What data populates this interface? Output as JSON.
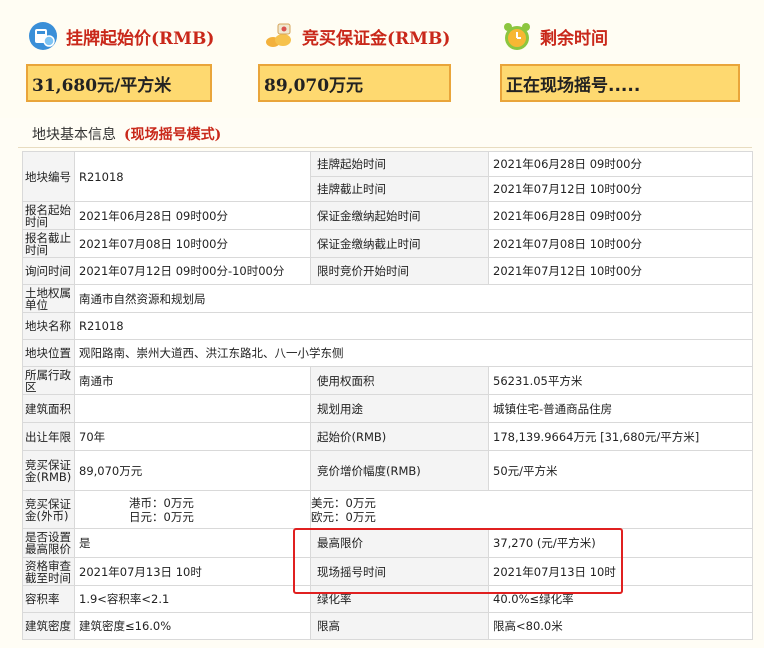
{
  "header": {
    "start_price": {
      "title": "挂牌起始价(RMB)",
      "value": "31,680元/平方米",
      "icon": "calculator-icon"
    },
    "deposit": {
      "title": "竞买保证金(RMB)",
      "value": "89,070万元",
      "icon": "coins-icon"
    },
    "remaining": {
      "title": "剩余时间",
      "value": "正在现场摇号.....",
      "icon": "alarm-clock-icon"
    }
  },
  "section": {
    "title": "地块基本信息",
    "mode": "(现场摇号模式)"
  },
  "rows": {
    "parcel_no_label": "地块编号",
    "parcel_no": "R21018",
    "list_start_label": "挂牌起始时间",
    "list_start": "2021年06月28日 09时00分",
    "list_end_label": "挂牌截止时间",
    "list_end": "2021年07月12日 10时00分",
    "reg_start_label": "报名起始时间",
    "reg_start": "2021年06月28日 09时00分",
    "dep_start_label": "保证金缴纳起始时间",
    "dep_start": "2021年06月28日 09时00分",
    "reg_end_label": "报名截止时间",
    "reg_end": "2021年07月08日 10时00分",
    "dep_end_label": "保证金缴纳截止时间",
    "dep_end": "2021年07月08日 10时00分",
    "inquiry_label": "询问时间",
    "inquiry": "2021年07月12日 09时00分-10时00分",
    "bid_start_label": "限时竞价开始时间",
    "bid_start": "2021年07月12日 10时00分",
    "owner_label": "土地权属单位",
    "owner": "南通市自然资源和规划局",
    "name_label": "地块名称",
    "name": "R21018",
    "location_label": "地块位置",
    "location": "观阳路南、崇州大道西、洪江东路北、八一小学东侧",
    "district_label": "所属行政区",
    "district": "南通市",
    "use_area_label": "使用权面积",
    "use_area": "56231.05平方米",
    "build_area_label": "建筑面积",
    "build_area": "",
    "plan_use_label": "规划用途",
    "plan_use": "城镇住宅-普通商品住房",
    "term_label": "出让年限",
    "term": "70年",
    "start_price_label": "起始价(RMB)",
    "start_price": "178,139.9664万元 [31,680元/平方米]",
    "deposit_label": "竞买保证金(RMB)",
    "deposit": "89,070万元",
    "increment_label": "竞价增价幅度(RMB)",
    "increment": "50元/平方米",
    "deposit_fx_label": "竞买保证金(外币)",
    "hkd": "港币：0万元",
    "jpy": "日元：0万元",
    "usd": "美元：0万元",
    "eur": "欧元：0万元",
    "cap_label": "是否设置最高限价",
    "cap": "是",
    "max_price_label": "最高限价",
    "max_price": "37,270 (元/平方米)",
    "qual_label": "资格审查截至时间",
    "qual": "2021年07月13日 10时",
    "lottery_label": "现场摇号时间",
    "lottery": "2021年07月13日 10时",
    "far_label": "容积率",
    "far": "1.9<容积率<2.1",
    "green_label": "绿化率",
    "green": "40.0%≤绿化率",
    "density_label": "建筑密度",
    "density": "建筑密度≤16.0%",
    "height_label": "限高",
    "height": "限高<80.0米"
  }
}
